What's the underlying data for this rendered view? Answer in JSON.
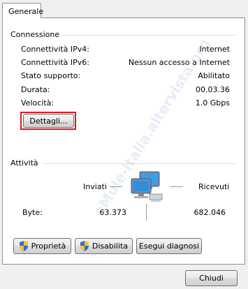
{
  "tab": {
    "label": "Generale"
  },
  "connection": {
    "heading": "Connessione",
    "rows": [
      {
        "label": "Connettività IPv4:",
        "value": "Internet"
      },
      {
        "label": "Connettività IPv6:",
        "value": "Nessun accesso a Internet"
      },
      {
        "label": "Stato supporto:",
        "value": "Abilitato"
      },
      {
        "label": "Durata:",
        "value": "00.03.36"
      },
      {
        "label": "Velocità:",
        "value": "1.0 Gbps"
      }
    ],
    "details_button": "Dettagli..."
  },
  "activity": {
    "heading": "Attività",
    "sent_label": "Inviati",
    "received_label": "Ricevuti",
    "bytes_label": "Byte:",
    "sent_value": "63.373",
    "received_value": "682.046"
  },
  "buttons": {
    "properties": "Proprietà",
    "disable": "Disabilita",
    "diagnose": "Esegui diagnosi",
    "close": "Chiudi"
  },
  "watermark": "eMule-italia.altervista.org"
}
